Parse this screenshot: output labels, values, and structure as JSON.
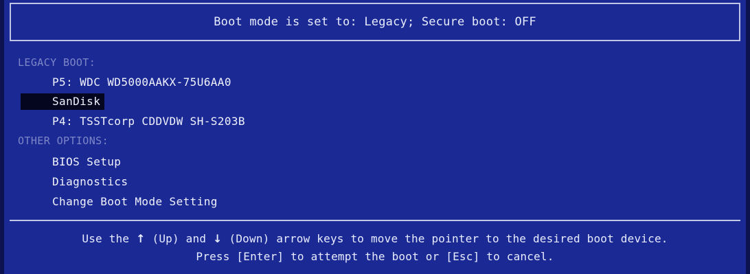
{
  "header": {
    "title": "Boot mode is set to: Legacy; Secure boot: OFF"
  },
  "menu": {
    "legacy_label": "LEGACY BOOT:",
    "legacy_items": [
      {
        "label": "P5: WDC WD5000AAKX-75U6AA0"
      },
      {
        "label": "SanDisk",
        "selected": true
      },
      {
        "label": "P4: TSSTcorp CDDVDW SH-S203B"
      }
    ],
    "other_label": "OTHER OPTIONS:",
    "other_items": [
      {
        "label": "BIOS Setup"
      },
      {
        "label": "Diagnostics"
      },
      {
        "label": "Change Boot Mode Setting"
      }
    ]
  },
  "footer": {
    "line1_a": "Use the",
    "up_arrow": "↑",
    "line1_b": "(Up) and",
    "down_arrow": "↓",
    "line1_c": "(Down) arrow keys to move the pointer to the desired boot device.",
    "line2": "Press [Enter] to attempt the boot or [Esc] to cancel."
  },
  "colors": {
    "background": "#1b2994",
    "text": "#f1f3ff",
    "section_label": "#7d86c7",
    "selection": "#04051e",
    "border": "#bfc6e6"
  }
}
